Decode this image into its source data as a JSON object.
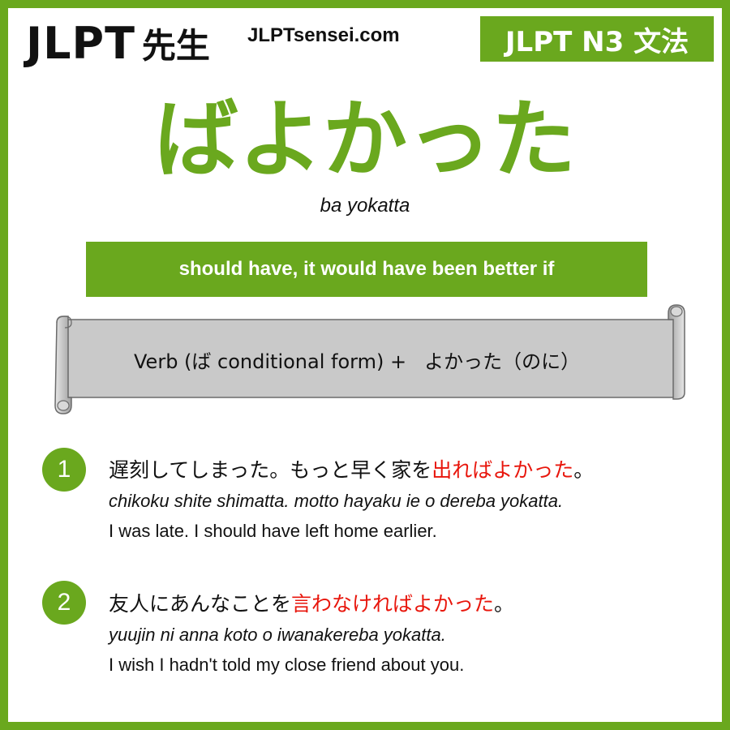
{
  "header": {
    "logo_jlpt": "JLPT",
    "logo_sensei": "先生",
    "site_url": "JLPTsensei.com",
    "level_badge": "JLPT N3 文法"
  },
  "grammar": {
    "title": "ばよかった",
    "romaji": "ba yokatta",
    "meaning": "should have, it would have been better if"
  },
  "formation": {
    "prefix": "Verb (ば conditional form) +",
    "suffix": "よかった（のに）"
  },
  "examples": [
    {
      "number": "1",
      "jp_before": "遅刻してしまった。もっと早く家を",
      "jp_highlight": "出ればよかった",
      "jp_after": "。",
      "romaji": "chikoku shite shimatta. motto hayaku ie o dereba yokatta.",
      "english": "I was late. I should have left home earlier."
    },
    {
      "number": "2",
      "jp_before": "友人にあんなことを",
      "jp_highlight": "言わなければよかった",
      "jp_after": "。",
      "romaji": "yuujin ni anna koto o iwanakereba yokatta.",
      "english": "I wish I hadn't told my close friend about you."
    }
  ],
  "colors": {
    "accent_green": "#6aa81e",
    "highlight_red": "#e8160c",
    "scroll_gray": "#c9c9c9"
  }
}
